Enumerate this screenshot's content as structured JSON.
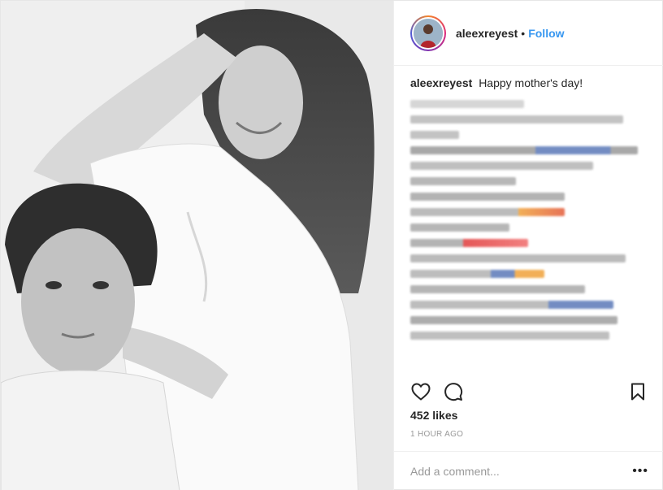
{
  "post": {
    "author": "aleexreyest",
    "follow_label": "Follow",
    "separator": "•",
    "caption_text": "Happy mother's day!",
    "likes": "452 likes",
    "time_ago": "1 HOUR AGO",
    "comment_placeholder": "Add a comment...",
    "more_label": "•••"
  },
  "icons": {
    "like": "heart-icon",
    "comment": "comment-icon",
    "save": "bookmark-icon",
    "options": "more-icon"
  },
  "colors": {
    "link_blue": "#3897f0",
    "text": "#262626",
    "muted": "#999999",
    "story_ring": "#dd2a7b"
  }
}
